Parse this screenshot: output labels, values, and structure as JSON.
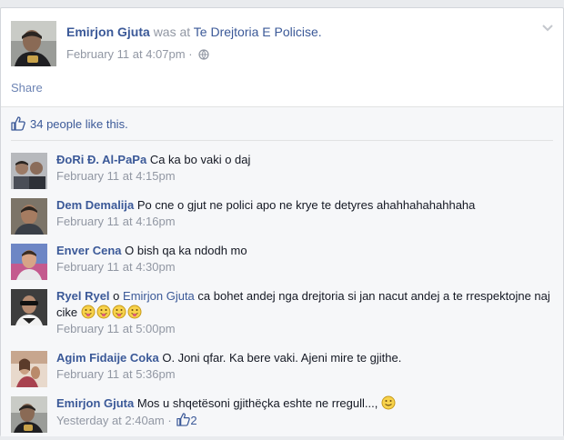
{
  "post": {
    "author": "Emirjon Gjuta",
    "was_at": "was at",
    "location": "Te Drejtoria E Policise.",
    "timestamp": "February 11 at 4:07pm",
    "separator": "·",
    "audience_icon": "globe-icon"
  },
  "share_label": "Share",
  "likes_text": "34 people like this.",
  "comments": [
    {
      "name": "ĐoRi Đ. Al-PaPa",
      "text": "Ca ka bo vaki o daj",
      "time": "February 11 at 4:15pm"
    },
    {
      "name": "Dem Demalija",
      "text": "Po cne o gjut ne polici apo ne krye te detyres ahahhahahahhaha",
      "time": "February 11 at 4:16pm"
    },
    {
      "name": "Enver Cena",
      "text": "O bish qa ka ndodh mo",
      "time": "February 11 at 4:30pm"
    },
    {
      "name": "Ryel Ryel",
      "prefix": "o",
      "tag": "Emirjon Gjuta",
      "text": "ca bohet andej nga drejtoria si jan nacut andej a te rrespektojne naj cike",
      "time": "February 11 at 5:00pm",
      "emoji_icon": "tongue-emoji-icon"
    },
    {
      "name": "Agim Fidaije Coka",
      "text": "O. Joni qfar. Ka bere vaki. Ajeni mire te gjithe.",
      "time": "February 11 at 5:36pm"
    },
    {
      "name": "Emirjon Gjuta",
      "text": "Mos u shqetësoni gjithëçka eshte ne rregull...,",
      "time": "Yesterday at 2:40am",
      "separator": "·",
      "like_count": "2",
      "emoji_icon": "smile-emoji-icon"
    }
  ],
  "colors": {
    "link": "#3b5998",
    "meta": "#9197a3",
    "background": "#e9ebee",
    "ufi_background": "#f6f7f9"
  }
}
